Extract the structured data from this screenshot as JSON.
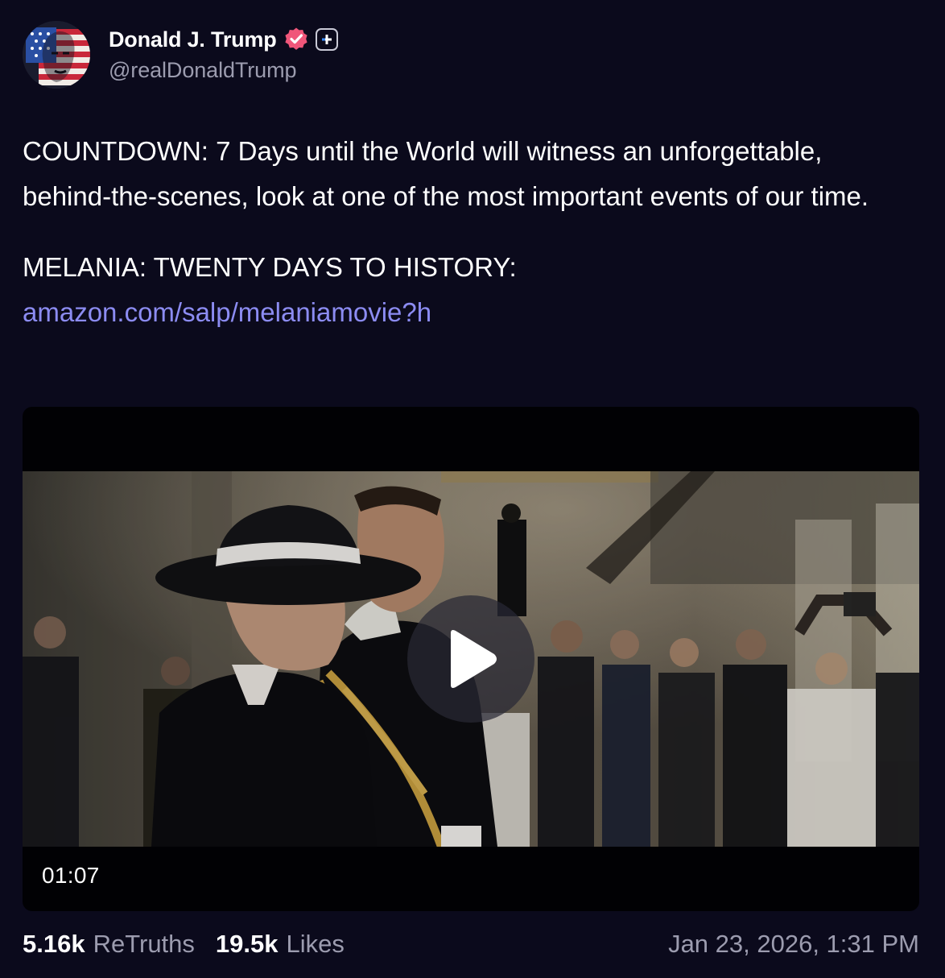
{
  "post": {
    "author": {
      "display_name": "Donald J. Trump",
      "handle": "@realDonaldTrump",
      "avatar_icon": "flag-portrait-avatar",
      "verified_icon": "verified-badge-icon",
      "plus_icon": "truth-plus-badge-icon"
    },
    "text": {
      "paragraph_1": "COUNTDOWN: 7 Days until the World will witness an unforgettable, behind-the-scenes, look at one of the most important events of our time.",
      "paragraph_2": "MELANIA: TWENTY DAYS TO HISTORY:",
      "link": "amazon.com/salp/melaniamovie?h"
    },
    "media": {
      "type": "video",
      "duration": "01:07",
      "play_icon": "play-icon"
    },
    "stats": {
      "retruths_count": "5.16k",
      "retruths_label": "ReTruths",
      "likes_count": "19.5k",
      "likes_label": "Likes"
    },
    "timestamp": "Jan 23, 2026, 1:31 PM"
  },
  "colors": {
    "background": "#0b0a1c",
    "link": "#8c8cf2",
    "muted_text": "#9c9caf",
    "verified": "#f0567a"
  }
}
